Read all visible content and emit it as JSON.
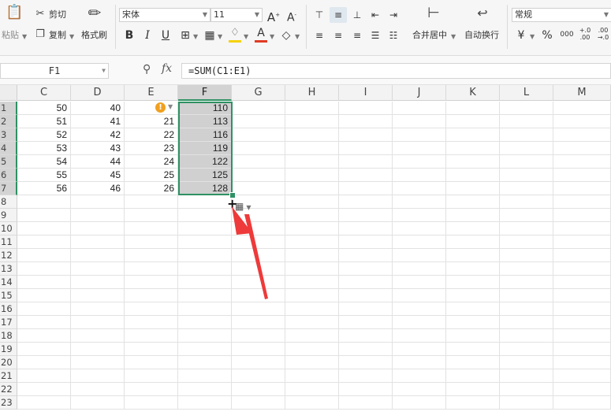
{
  "ribbon": {
    "paste_label": "粘贴",
    "cut_label": "剪切",
    "copy_label": "复制",
    "format_painter_label": "格式刷",
    "font_name": "宋体",
    "font_size": "11",
    "bold": "B",
    "italic": "I",
    "underline": "U",
    "merge_center_label": "合并居中",
    "wrap_text_label": "自动换行",
    "number_format": "常规",
    "currency_symbol": "¥",
    "percent_symbol": "%",
    "thousands_symbol": "000",
    "increase_decimal": "+.0\n.00",
    "decrease_decimal": ".00\n→.0",
    "font_color_accent": "#e03b24",
    "fill_color_accent": "#f5d20a"
  },
  "formula_bar": {
    "name_box": "F1",
    "fx_label": "fx",
    "formula": "=SUM(C1:E1)"
  },
  "grid": {
    "columns": [
      "C",
      "D",
      "E",
      "F",
      "G",
      "H",
      "I",
      "J",
      "K",
      "L",
      "M"
    ],
    "active_column": "F",
    "rows": [
      "1",
      "2",
      "3",
      "4",
      "5",
      "6",
      "7",
      "8",
      "9",
      "10",
      "11",
      "12",
      "13",
      "14",
      "15",
      "16",
      "17",
      "18",
      "19",
      "20",
      "21",
      "22",
      "23"
    ],
    "data": [
      {
        "C": "50",
        "D": "40",
        "E": "",
        "F": "110"
      },
      {
        "C": "51",
        "D": "41",
        "E": "21",
        "F": "113"
      },
      {
        "C": "52",
        "D": "42",
        "E": "22",
        "F": "116"
      },
      {
        "C": "53",
        "D": "43",
        "E": "23",
        "F": "119"
      },
      {
        "C": "54",
        "D": "44",
        "E": "24",
        "F": "122"
      },
      {
        "C": "55",
        "D": "45",
        "E": "25",
        "F": "125"
      },
      {
        "C": "56",
        "D": "46",
        "E": "26",
        "F": "128"
      }
    ],
    "selection_color": "#2e9163",
    "arrow_color": "#ee3a3a"
  }
}
